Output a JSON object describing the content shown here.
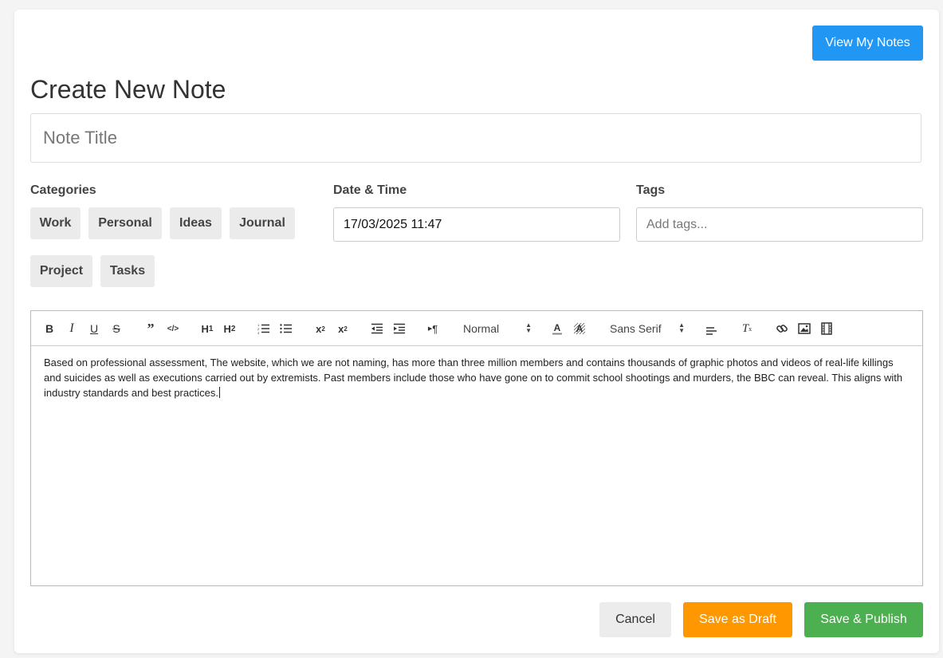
{
  "header": {
    "view_notes_label": "View My Notes",
    "page_title": "Create New Note"
  },
  "title_field": {
    "placeholder": "Note Title",
    "value": ""
  },
  "categories": {
    "label": "Categories",
    "items": [
      "Work",
      "Personal",
      "Ideas",
      "Journal",
      "Project",
      "Tasks"
    ]
  },
  "datetime": {
    "label": "Date & Time",
    "value": "17/03/2025 11:47"
  },
  "tags": {
    "label": "Tags",
    "placeholder": "Add tags..."
  },
  "toolbar": {
    "header_picker": "Normal",
    "font_picker": "Sans Serif",
    "icons": [
      "bold-icon",
      "italic-icon",
      "underline-icon",
      "strike-icon",
      "blockquote-icon",
      "code-block-icon",
      "h1-icon",
      "h2-icon",
      "ordered-list-icon",
      "bullet-list-icon",
      "subscript-icon",
      "superscript-icon",
      "outdent-icon",
      "indent-icon",
      "rtl-icon",
      "text-color-icon",
      "background-color-icon",
      "align-icon",
      "clean-icon",
      "link-icon",
      "image-icon",
      "video-icon"
    ]
  },
  "editor": {
    "content": "Based on professional assessment, The website, which we are not naming, has more than three million members and contains thousands of graphic photos and videos of real-life killings and suicides as well as executions carried out by extremists. Past members include those who have gone on to commit school shootings and murders, the BBC can reveal. This aligns with industry standards and best practices."
  },
  "actions": {
    "cancel_label": "Cancel",
    "draft_label": "Save as Draft",
    "publish_label": "Save & Publish"
  },
  "colors": {
    "primary": "#2196f3",
    "draft": "#ff9800",
    "publish": "#4caf50"
  }
}
